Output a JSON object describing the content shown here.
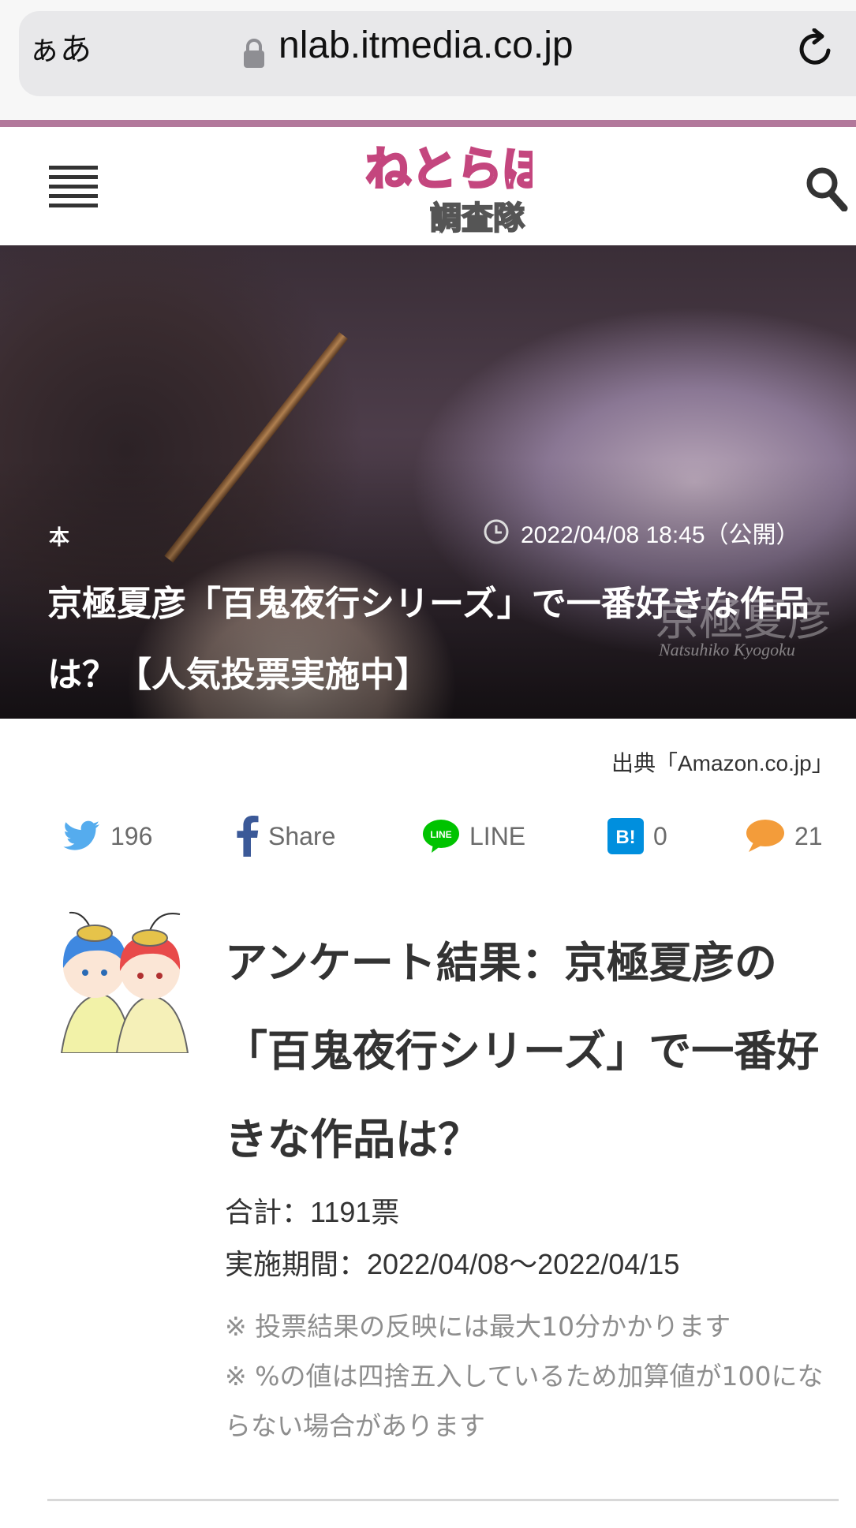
{
  "browser": {
    "aa_label": "ぁあ",
    "url": "nlab.itmedia.co.jp"
  },
  "header": {
    "logo_main": "ねとらぼ",
    "logo_sub": "調査隊"
  },
  "hero": {
    "category": "本",
    "date": "2022/04/08 18:45（公開）",
    "title": "京極夏彦「百鬼夜行シリーズ」で一番好きな作品は？【人気投票実施中】",
    "image_text": "京極夏彦",
    "image_subtext": "Natsuhiko Kyogoku"
  },
  "source": "出典「Amazon.co.jp」",
  "share": {
    "twitter_count": "196",
    "facebook_label": "Share",
    "line_label": "LINE",
    "hatena_count": "0",
    "comment_count": "21"
  },
  "survey": {
    "title": "アンケート結果：京極夏彦の「百鬼夜行シリーズ」で一番好きな作品は？",
    "total": "合計：1191票",
    "period": "実施期間：2022/04/08～2022/04/15",
    "note1": "※ 投票結果の反映には最大10分かかります",
    "note2": "※ %の値は四捨五入しているため加算値が100にならない場合があります"
  },
  "colors": {
    "accent_line": "#b2789b",
    "logo_pink": "#c4467e",
    "twitter": "#55acee",
    "facebook": "#3b5998",
    "line": "#00c300",
    "hatena": "#008fde",
    "comment": "#f39c3a"
  }
}
